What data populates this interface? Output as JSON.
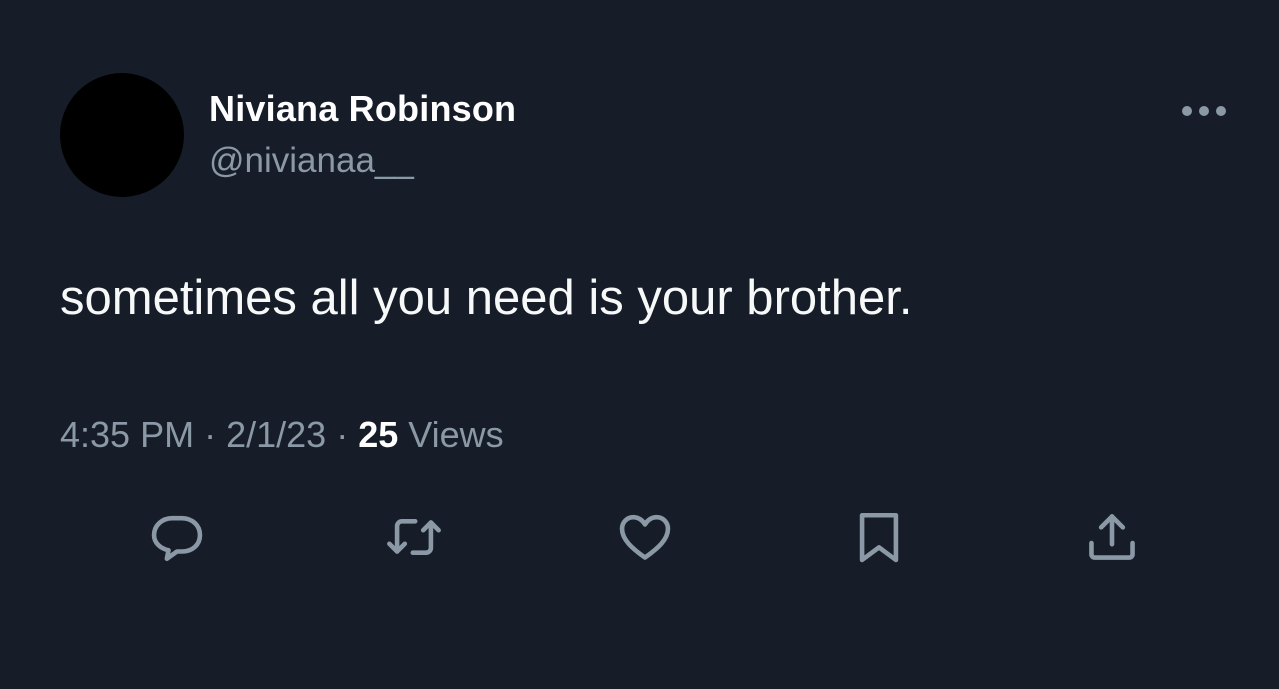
{
  "tweet": {
    "display_name": "Niviana Robinson",
    "handle": "@nivianaa__",
    "text": "sometimes all you need is your brother.",
    "time": "4:35 PM",
    "separator": "·",
    "date": "2/1/23",
    "views_count": "25",
    "views_label": "Views"
  },
  "actions": [
    {
      "name": "reply",
      "icon": "reply-icon"
    },
    {
      "name": "retweet",
      "icon": "retweet-icon"
    },
    {
      "name": "like",
      "icon": "heart-icon"
    },
    {
      "name": "bookmark",
      "icon": "bookmark-icon"
    },
    {
      "name": "share",
      "icon": "share-icon"
    }
  ],
  "colors": {
    "background": "#161d29",
    "primary_text": "#ffffff",
    "secondary_text": "#8b98a5",
    "avatar": "#000000"
  }
}
